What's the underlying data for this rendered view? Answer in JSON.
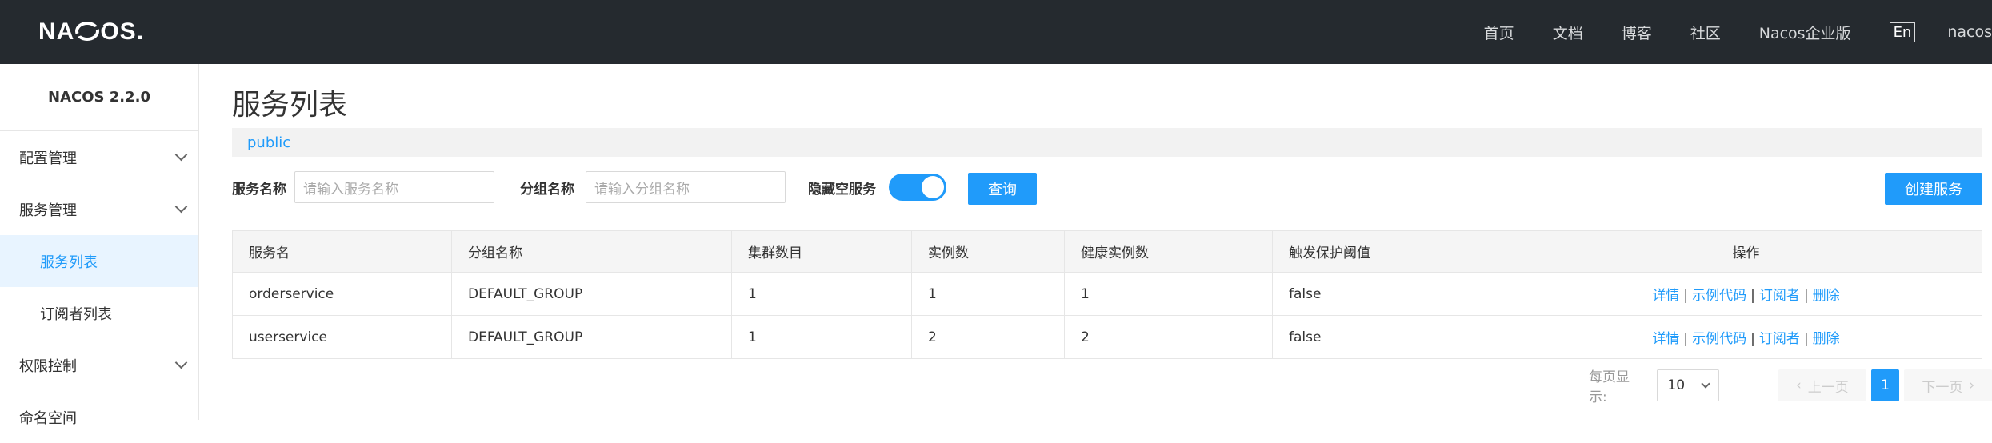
{
  "topbar": {
    "logo": "NACOS.",
    "nav": [
      "首页",
      "文档",
      "博客",
      "社区",
      "Nacos企业版"
    ],
    "lang": "En",
    "user": "nacos"
  },
  "sidebar": {
    "version": "NACOS 2.2.0",
    "items": [
      {
        "label": "配置管理"
      },
      {
        "label": "服务管理"
      },
      {
        "label": "服务列表"
      },
      {
        "label": "订阅者列表"
      },
      {
        "label": "权限控制"
      },
      {
        "label": "命名空间"
      }
    ]
  },
  "main": {
    "title": "服务列表",
    "namespace": "public",
    "filters": {
      "service_label": "服务名称",
      "service_placeholder": "请输入服务名称",
      "group_label": "分组名称",
      "group_placeholder": "请输入分组名称",
      "hide_empty_label": "隐藏空服务",
      "hide_empty_on": true,
      "query_button": "查询",
      "create_button": "创建服务"
    },
    "table": {
      "headers": [
        "服务名",
        "分组名称",
        "集群数目",
        "实例数",
        "健康实例数",
        "触发保护阈值",
        "操作"
      ],
      "rows": [
        {
          "name": "orderservice",
          "group": "DEFAULT_GROUP",
          "clusters": "1",
          "instances": "1",
          "healthy": "1",
          "protect": "false"
        },
        {
          "name": "userservice",
          "group": "DEFAULT_GROUP",
          "clusters": "1",
          "instances": "2",
          "healthy": "2",
          "protect": "false"
        }
      ],
      "actions": {
        "detail": "详情",
        "sample": "示例代码",
        "subscriber": "订阅者",
        "delete": "删除",
        "separator": "|"
      }
    },
    "pagination": {
      "page_size_label": "每页显示:",
      "page_size": "10",
      "prev": "上一页",
      "current": "1",
      "next": "下一页"
    }
  },
  "colors": {
    "topbar": "#252a2f",
    "accent": "#209bfa",
    "active_bg": "#e8f4ff"
  }
}
